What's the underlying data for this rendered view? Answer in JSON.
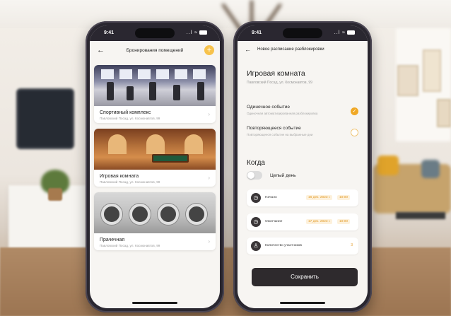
{
  "status": {
    "time": "9:41",
    "signal": "..l ≈"
  },
  "left_screen": {
    "nav_title": "Бронирования помещений",
    "back_icon": "arrow-left-icon",
    "add_icon": "plus-icon",
    "add_symbol": "+",
    "back_symbol": "←",
    "chevron_symbol": "›",
    "rooms": [
      {
        "name": "Спортивный комплекс",
        "address": "Павловский Посад, ул. Космонавтов, 99"
      },
      {
        "name": "Игровая комната",
        "address": "Павловский Посад, ул. Космонавтов, 99"
      },
      {
        "name": "Прачечная",
        "address": "Павловский Посад, ул. Космонавтов, 99"
      }
    ]
  },
  "right_screen": {
    "back_symbol": "←",
    "nav_title": "Новое расписание разблокировки",
    "room_title": "Игровая комната",
    "room_address": "Павловский Посад, ул. Космонавтов, 99",
    "options": [
      {
        "label": "Одиночное событие",
        "description": "Одиночная автоматизированная разблокировка",
        "selected": true,
        "mark": "✓"
      },
      {
        "label": "Повторяющееся событие",
        "description": "Повторяющееся событие на выбранные дни",
        "selected": false,
        "mark": ""
      }
    ],
    "when_title": "Когда",
    "all_day_label": "Целый день",
    "all_day_on": false,
    "start": {
      "label": "Начало",
      "date": "16 дек. 2023 г.",
      "time": "10:00",
      "icon": "clock-icon",
      "symbol": "◷"
    },
    "end": {
      "label": "Окончание",
      "date": "17 дек. 2023 г.",
      "time": "10:00",
      "icon": "clock-icon",
      "symbol": "◷"
    },
    "participants": {
      "label": "Количество участников",
      "value": "3",
      "icon": "person-icon",
      "symbol": "♙"
    },
    "save_label": "Сохранить"
  },
  "colors": {
    "accent": "#f0a826",
    "dark": "#2e2a2d",
    "screen_bg": "#f7f5f2"
  }
}
